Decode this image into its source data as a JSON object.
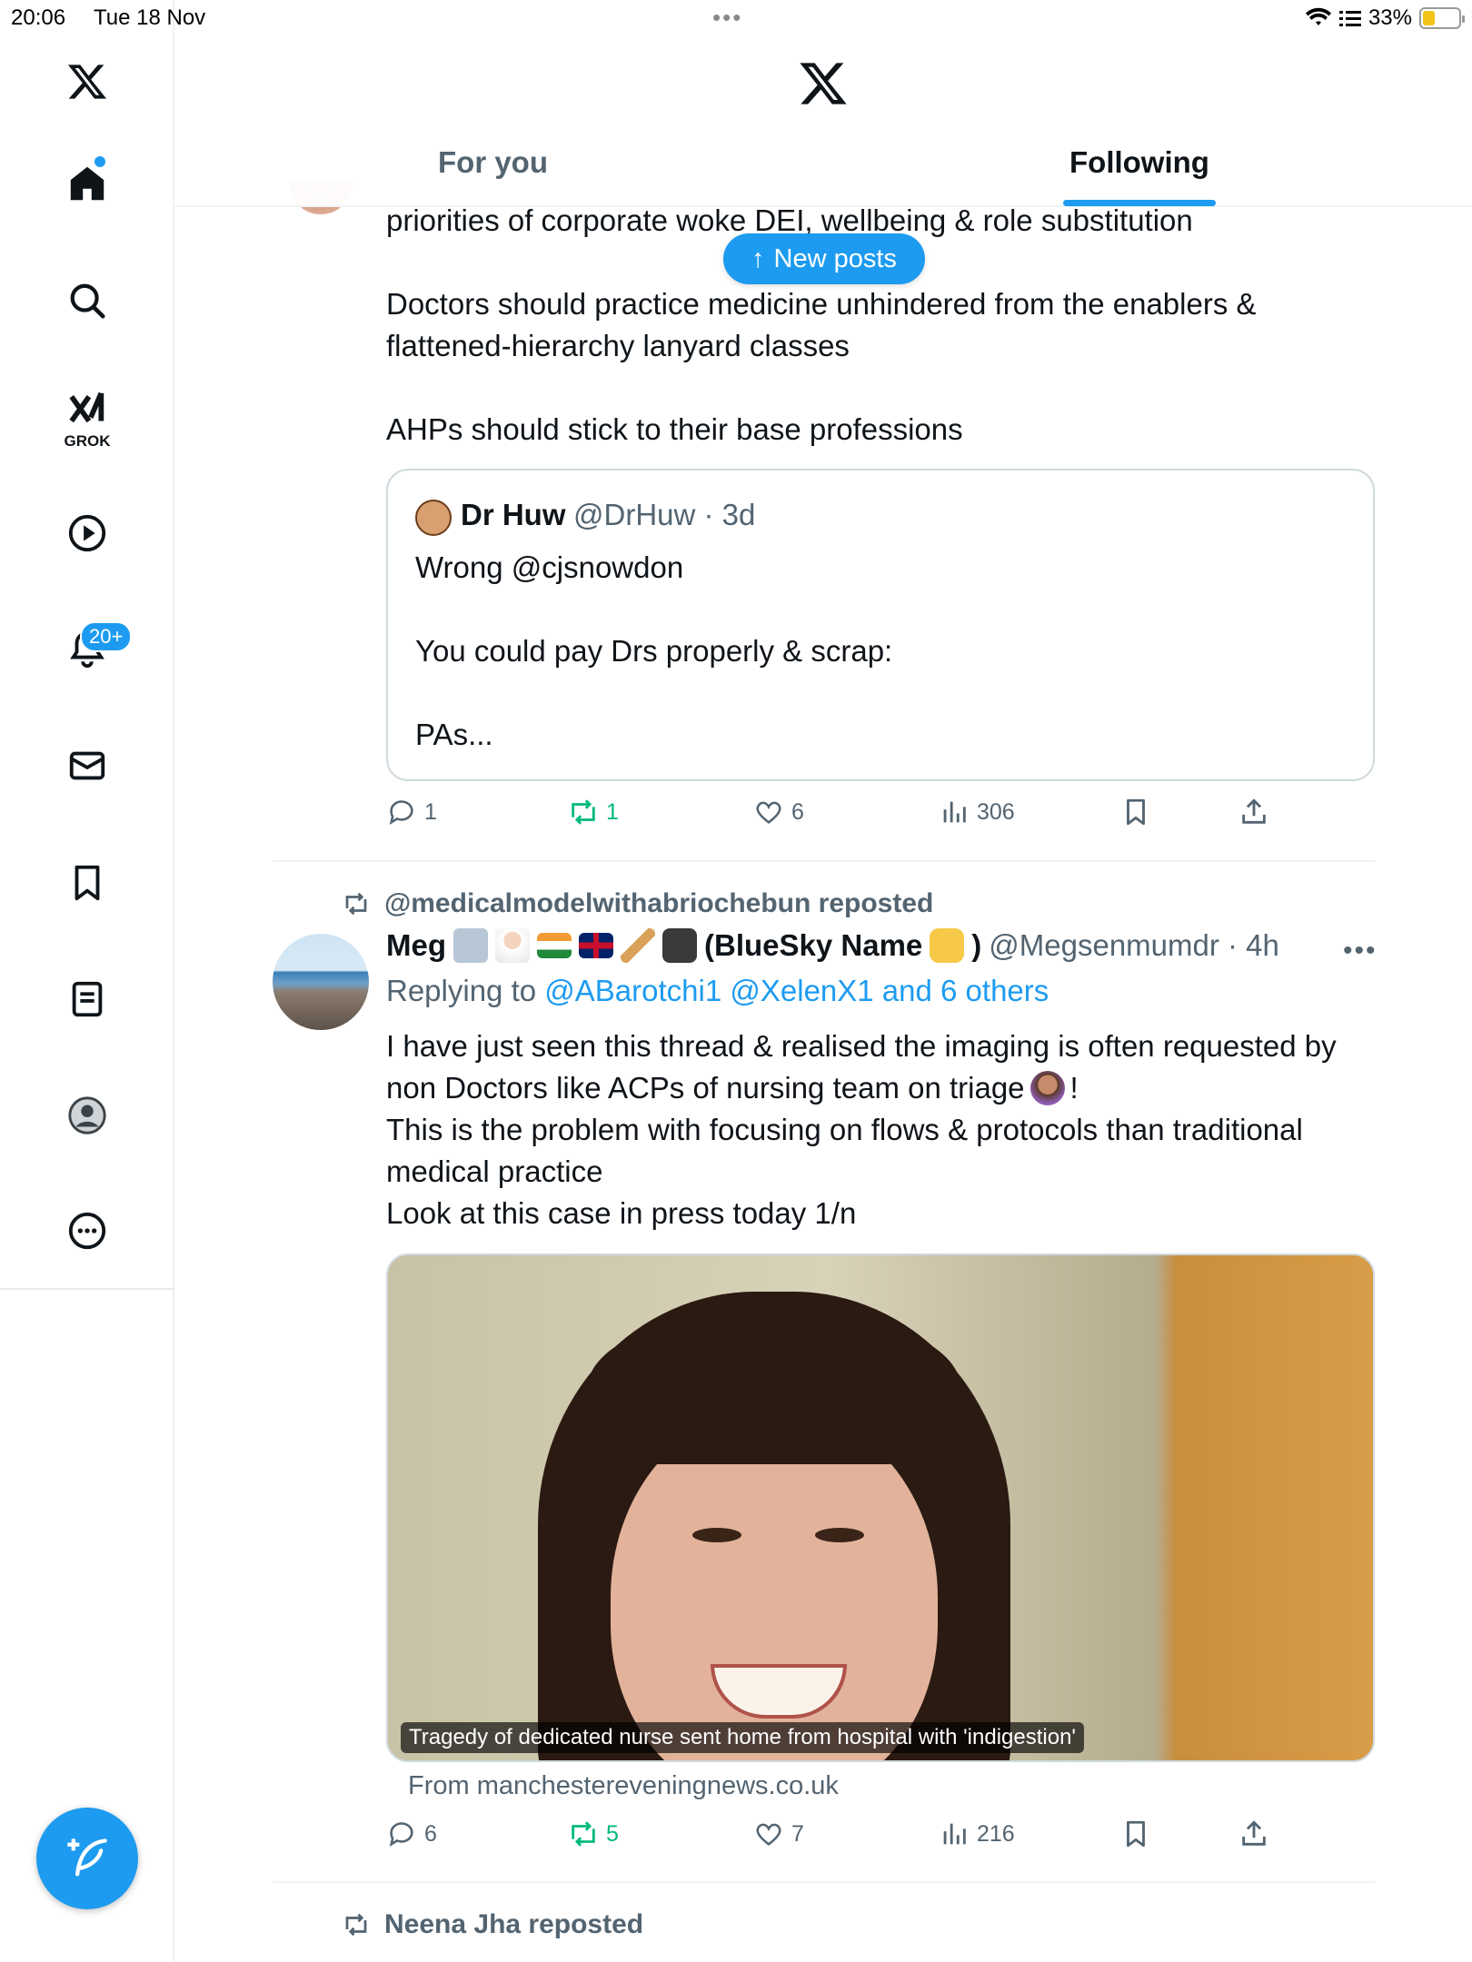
{
  "status_bar": {
    "time": "20:06",
    "date": "Tue 18 Nov",
    "battery": "33%",
    "battery_level": 0.33
  },
  "sidebar": {
    "grok_label": "GROK",
    "notifications_badge": "20+",
    "items": [
      {
        "icon": "x-logo-icon"
      },
      {
        "icon": "home-icon"
      },
      {
        "icon": "search-icon"
      },
      {
        "icon": "grok-icon"
      },
      {
        "icon": "video-icon"
      },
      {
        "icon": "bell-icon"
      },
      {
        "icon": "mail-icon"
      },
      {
        "icon": "bookmark-icon"
      },
      {
        "icon": "list-icon"
      },
      {
        "icon": "profile-icon"
      },
      {
        "icon": "more-icon"
      }
    ]
  },
  "header": {
    "tabs": [
      {
        "label": "For you",
        "active": false
      },
      {
        "label": "Following",
        "active": true
      }
    ]
  },
  "new_posts_label": "New posts",
  "post1": {
    "text_lines": [
      "priorities of corporate woke DEI, wellbeing & role substitution",
      "Doctors should practice medicine unhindered from the enablers &",
      "flattened-hierarchy lanyard classes",
      "AHPs should stick to their base professions"
    ],
    "quote": {
      "name": "Dr Huw",
      "handle_time": "@DrHuw · 3d",
      "lines": [
        "Wrong @cjsnowdon",
        "You could pay Drs properly & scrap:",
        "PAs..."
      ]
    },
    "stats": {
      "replies": "1",
      "reposts": "1",
      "likes": "6",
      "views": "306"
    }
  },
  "post2": {
    "reposted_by": "@medicalmodelwithabriochebun reposted",
    "name": "Meg",
    "name_suffix": "(BlueSky Name",
    "name_close": ")",
    "handle_time": "@Megsenmumdr · 4h",
    "replying_prefix": "Replying to",
    "replying_to": "@ABarotchi1 @XelenX1 and 6 others",
    "text_lines": [
      "I have just seen this thread & realised the imaging is often requested by",
      "non Doctors like ACPs of nursing team on triage",
      "This is the problem with focusing on flows & protocols than traditional",
      "medical practice",
      "Look at this case in press today 1/n"
    ],
    "line2_suffix": "!",
    "media_caption": "Tragedy of dedicated nurse sent home from hospital with 'indigestion'",
    "from_link": "From manchestereveningnews.co.uk",
    "stats": {
      "replies": "6",
      "reposts": "5",
      "likes": "7",
      "views": "216"
    }
  },
  "post3": {
    "reposted_by": "Neena Jha reposted"
  },
  "colors": {
    "accent": "#1d9bf0",
    "repost_green": "#00ba7c",
    "secondary_text": "#536471"
  }
}
